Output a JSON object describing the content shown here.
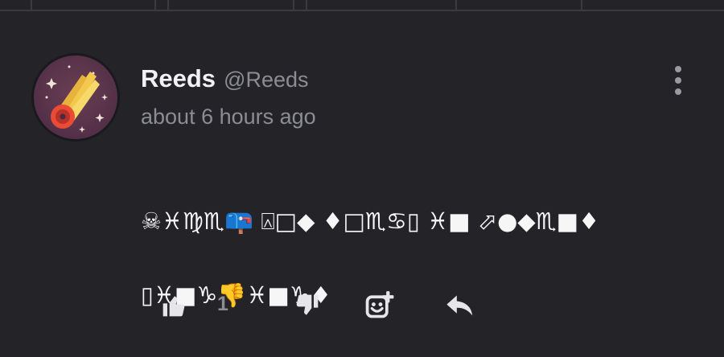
{
  "post": {
    "author_name": "Reeds",
    "author_handle": "@Reeds",
    "timestamp": "about 6 hours ago",
    "body_line1": "☠♓♍♏📪 ⍓□◆ ♦□♏♋▯ ♓■ ⬀●◆♏■♦",
    "body_line2": "▯♓■♑👎♓■♑♦",
    "avatar_icon": "comet-avatar"
  },
  "actions": {
    "like_count": "1",
    "like_icon": "thumbs-up-icon",
    "dislike_icon": "thumbs-down-icon",
    "react_icon": "add-reaction-icon",
    "reply_icon": "reply-icon",
    "menu_icon": "more-vertical-icon"
  },
  "colors": {
    "background": "#232328",
    "text_primary": "#f2f2f4",
    "text_secondary": "#8c8c94",
    "icon": "#e6e6ea"
  }
}
